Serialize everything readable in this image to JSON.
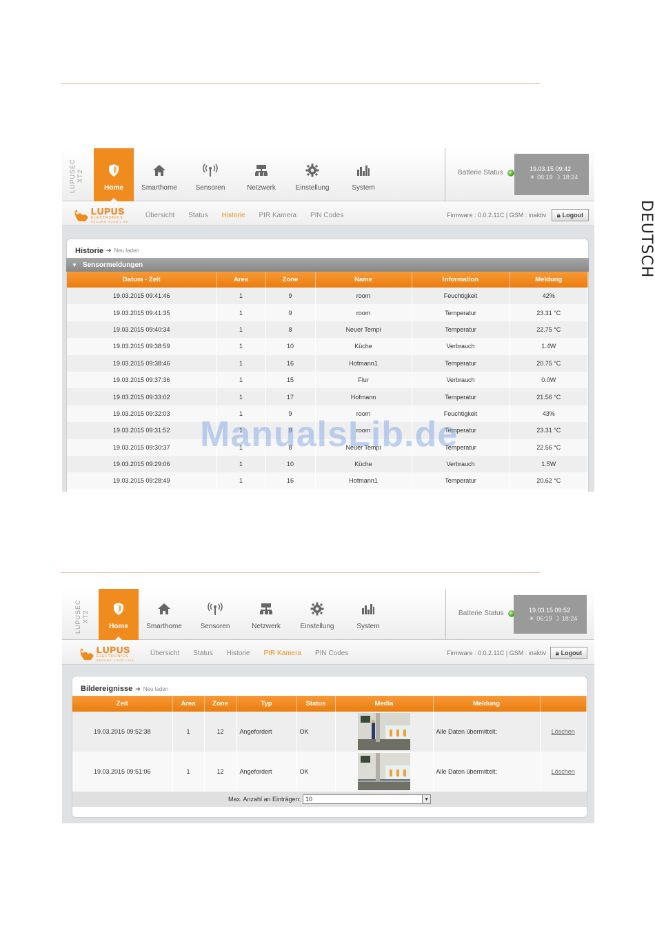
{
  "side_label": "DEUTSCH",
  "watermark": "ManualsLib.de",
  "colors": {
    "accent": "#f08c1e",
    "header_gray": "#9a9a9a"
  },
  "screen1": {
    "brand": "LUPUSEC XT2",
    "nav": [
      {
        "label": "Home",
        "icon": "shield-icon",
        "active": true
      },
      {
        "label": "Smarthome",
        "icon": "house-icon"
      },
      {
        "label": "Sensoren",
        "icon": "antenna-icon"
      },
      {
        "label": "Netzwerk",
        "icon": "network-icon"
      },
      {
        "label": "Einstellung",
        "icon": "gear-icon"
      },
      {
        "label": "System",
        "icon": "bars-icon"
      }
    ],
    "battery_label": "Batterie Status",
    "datetime": "19.03.15 09:42",
    "sunrise": "06:19",
    "sunset": "18:24",
    "logo_name": "LUPUS",
    "logo_sub": "ELECTRONICS",
    "logo_tag": "SECURE YOUR LIFE",
    "subnav": [
      "Übersicht",
      "Status",
      "Historie",
      "PIR Kamera",
      "PIN Codes"
    ],
    "subnav_active": 2,
    "firmware": "Firmware : 0.0.2.11C | GSM : inaktiv",
    "logout": "Logout",
    "panel_title": "Historie",
    "reload": "Neu laden",
    "section": "Sensormeldungen",
    "columns": [
      "Datum - Zeit",
      "Area",
      "Zone",
      "Name",
      "Information",
      "Meldung"
    ],
    "rows": [
      [
        "19.03.2015 09:41:46",
        "1",
        "9",
        "room",
        "Feuchtigkeit",
        "42%"
      ],
      [
        "19.03.2015 09:41:35",
        "1",
        "9",
        "room",
        "Temperatur",
        "23.31 °C"
      ],
      [
        "19.03.2015 09:40:34",
        "1",
        "8",
        "Neuer Tempi",
        "Temperatur",
        "22.75 °C"
      ],
      [
        "19.03.2015 09:38:59",
        "1",
        "10",
        "Küche",
        "Verbrauch",
        "1.4W"
      ],
      [
        "19.03.2015 09:38:46",
        "1",
        "16",
        "Hofmann1",
        "Temperatur",
        "20.75 °C"
      ],
      [
        "19.03.2015 09:37:36",
        "1",
        "15",
        "Flur",
        "Verbrauch",
        "0.0W"
      ],
      [
        "19.03.2015 09:33:02",
        "1",
        "17",
        "Hofmann",
        "Temperatur",
        "21.56 °C"
      ],
      [
        "19.03.2015 09:32:03",
        "1",
        "9",
        "room",
        "Feuchtigkeit",
        "43%"
      ],
      [
        "19.03.2015 09:31:52",
        "1",
        "9",
        "room",
        "Temperatur",
        "23.31 °C"
      ],
      [
        "19.03.2015 09:30:37",
        "1",
        "8",
        "Neuer Tempi",
        "Temperatur",
        "22.56 °C"
      ],
      [
        "19.03.2015 09:29:06",
        "1",
        "10",
        "Küche",
        "Verbrauch",
        "1.5W"
      ],
      [
        "19.03.2015 09:28:49",
        "1",
        "16",
        "Hofmann1",
        "Temperatur",
        "20.62 °C"
      ]
    ]
  },
  "screen2": {
    "brand": "LUPUSEC XT2",
    "nav": [
      {
        "label": "Home",
        "icon": "shield-icon",
        "active": true
      },
      {
        "label": "Smarthome",
        "icon": "house-icon"
      },
      {
        "label": "Sensoren",
        "icon": "antenna-icon"
      },
      {
        "label": "Netzwerk",
        "icon": "network-icon"
      },
      {
        "label": "Einstellung",
        "icon": "gear-icon"
      },
      {
        "label": "System",
        "icon": "bars-icon"
      }
    ],
    "battery_label": "Batterie Status",
    "datetime": "19.03.15 09:52",
    "sunrise": "06:19",
    "sunset": "18:24",
    "logo_name": "LUPUS",
    "logo_sub": "ELECTRONICS",
    "logo_tag": "SECURE YOUR LIFE",
    "subnav": [
      "Übersicht",
      "Status",
      "Historie",
      "PIR Kamera",
      "PIN Codes"
    ],
    "subnav_active": 3,
    "firmware": "Firmware : 0.0.2.11C | GSM : inaktiv",
    "logout": "Logout",
    "panel_title": "Bildereignisse",
    "reload": "Neu laden",
    "columns": [
      "Zeit",
      "Area",
      "Zone",
      "Typ",
      "Status",
      "Media",
      "Meldung",
      ""
    ],
    "rows": [
      {
        "zeit": "19.03.2015 09:52:38",
        "area": "1",
        "zone": "12",
        "typ": "Angefordert",
        "status": "OK",
        "meldung": "Alle Daten übermittelt;",
        "action": "Löschen"
      },
      {
        "zeit": "19.03.2015 09:51:06",
        "area": "1",
        "zone": "12",
        "typ": "Angefordert",
        "status": "OK",
        "meldung": "Alle Daten übermittelt;",
        "action": "Löschen"
      }
    ],
    "max_label": "Max. Anzahl an Einträgen:",
    "max_value": "10"
  }
}
